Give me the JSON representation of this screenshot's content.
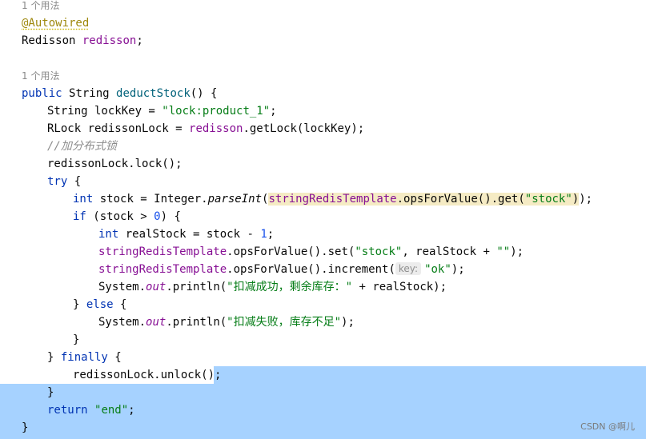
{
  "editor": {
    "usage_hint_1": "1 个用法",
    "usage_hint_2": "1 个用法",
    "annotation": "@Autowired",
    "field_type": "Redisson",
    "field_name": "redisson",
    "semicolon": ";",
    "method_decl": {
      "kw_public": "public",
      "type": "String",
      "name": "deductStock",
      "rest": "() {"
    },
    "lockkey": {
      "pre": "String lockKey = ",
      "str": "\"lock:product_1\"",
      "post": ";"
    },
    "rlock": {
      "pre": "RLock redissonLock = ",
      "fld": "redisson",
      "post": ".getLock(lockKey);"
    },
    "comment": "//加分布式锁",
    "lock_call": "redissonLock.lock();",
    "try_kw": "try",
    "try_rest": " {",
    "stock_line": {
      "kw": "int",
      "pre": " stock = Integer.",
      "method": "parseInt",
      "paren": "(",
      "fld": "stringRedisTemplate",
      "mid": ".opsForValue().get(",
      "str": "\"stock\"",
      "close": ")",
      "end": ");"
    },
    "if_line": {
      "kw": "if",
      "pre": " (stock > ",
      "num": "0",
      "post": ") {"
    },
    "realstock_line": {
      "kw": "int",
      "pre": " realStock = stock - ",
      "num": "1",
      "post": ";"
    },
    "set_line": {
      "fld": "stringRedisTemplate",
      "pre": ".opsForValue().set(",
      "str1": "\"stock\"",
      "mid": ", realStock + ",
      "str2": "\"\"",
      "post": ");"
    },
    "incr_line": {
      "fld": "stringRedisTemplate",
      "pre": ".opsForValue().increment(",
      "inlay": "key:",
      "str": "\"ok\"",
      "post": ");"
    },
    "println1": {
      "pre": "System.",
      "out": "out",
      "mid": ".println(",
      "str": "\"扣减成功，剩余库存：\"",
      "post": " + realStock);"
    },
    "else_line": {
      "pre": "} ",
      "kw": "else",
      "post": " {"
    },
    "println2": {
      "pre": "System.",
      "out": "out",
      "mid": ".println(",
      "str": "\"扣减失败，库存不足\"",
      "post": ");"
    },
    "close_brace": "}",
    "finally_line": {
      "pre": "} ",
      "kw": "finally",
      "post": " {"
    },
    "unlock_call": "redissonLock.unlock();",
    "return_line": {
      "kw": "return",
      "sp": " ",
      "str": "\"end\"",
      "post": ";"
    },
    "final_brace": "}"
  },
  "watermark": "CSDN @啊儿",
  "colors": {
    "keyword": "#0033b3",
    "field": "#871094",
    "string": "#067d17",
    "number": "#1750eb",
    "selection": "#a6d2ff",
    "highlight": "#f5ebc4"
  }
}
